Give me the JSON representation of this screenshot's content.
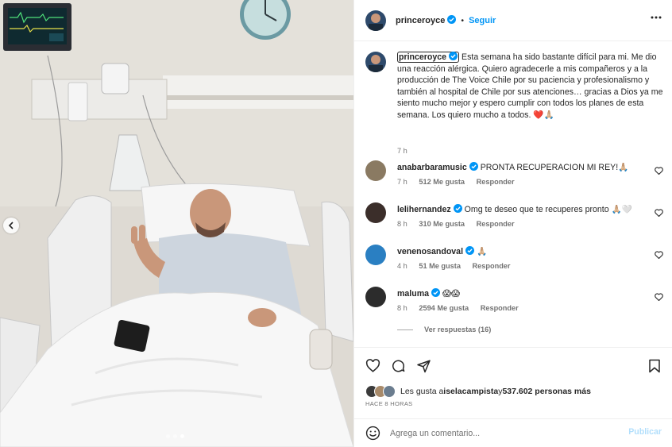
{
  "header": {
    "username": "princeroyce",
    "separator": "•",
    "follow_label": "Seguir"
  },
  "caption": {
    "username": "princeroyce",
    "text": "Esta semana ha sido bastante difícil para mi. Me dio una reacción alérgica. Quiero agradecerle a mis compañeros y a la producción de The Voice Chile por su paciencia y profesionalismo y también al hospital de Chile por sus atenciones… gracias a Dios ya me siento mucho mejor y espero cumplir con todos los planes de esta semana. Los quiero mucho a todos.",
    "emoji": "❤️🙏🏼",
    "time": "7 h"
  },
  "comments": [
    {
      "username": "anabarbaramusic",
      "text": "PRONTA RECUPERACION MI REY!🙏🏼",
      "time": "7 h",
      "likes": "512 Me gusta",
      "reply": "Responder",
      "avatar_color": "#8a7a62"
    },
    {
      "username": "lelihernandez",
      "text": "Omg te deseo que te recuperes pronto 🙏🏼🤍",
      "time": "8 h",
      "likes": "310 Me gusta",
      "reply": "Responder",
      "avatar_color": "#3b2e2a"
    },
    {
      "username": "venenosandoval",
      "text": "🙏🏼",
      "time": "4 h",
      "likes": "51 Me gusta",
      "reply": "Responder",
      "avatar_color": "#2a7fc2"
    },
    {
      "username": "maluma",
      "text": "😱😱",
      "time": "8 h",
      "likes": "2594 Me gusta",
      "reply": "Responder",
      "avatar_color": "#2c2c2c"
    }
  ],
  "see_replies": "Ver respuestas (16)",
  "likes_summary": {
    "prefix": "Les gusta a ",
    "first_user": "iselacampista",
    "middle": " y ",
    "count": "537.602 personas más"
  },
  "time_ago": "HACE 8 HORAS",
  "add_comment": {
    "placeholder": "Agrega un comentario...",
    "publish_label": "Publicar"
  },
  "carousel": {
    "total_slides": 3,
    "active_slide": 3
  },
  "colors": {
    "accent": "#0095f6",
    "verified": "#0095f6",
    "muted": "#737373",
    "text": "#262626"
  }
}
